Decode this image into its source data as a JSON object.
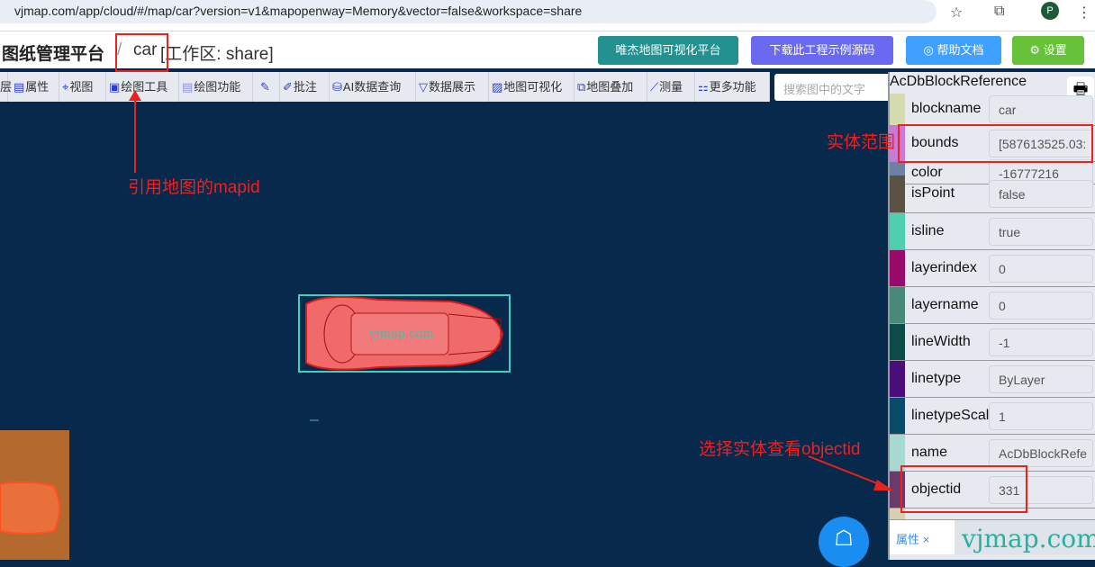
{
  "browser": {
    "url": "vjmap.com/app/cloud/#/map/car?version=v1&mapopenway=Memory&vector=false&workspace=share",
    "avatar": "P"
  },
  "header": {
    "title": "图纸管理平台",
    "separator": "/",
    "map_name": "car",
    "workspace": "[工作区: share]",
    "buttons": [
      {
        "label": "唯杰地图可视化平台",
        "color": "#22918f"
      },
      {
        "label": "下载此工程示例源码",
        "color": "#6a6af0"
      },
      {
        "label": "◎ 帮助文档",
        "color": "#40a0ff"
      },
      {
        "label": "⚙ 设置",
        "color": "#67c23a"
      }
    ]
  },
  "toolbar": {
    "items": [
      "层",
      "属性",
      "视图",
      "绘图工具",
      "绘图功能",
      "",
      "批注",
      "AI数据查询",
      "数据展示",
      "地图可视化",
      "地图叠加",
      "测量",
      "更多功能"
    ],
    "search_placeholder": "搜索图中的文字"
  },
  "panel": {
    "title": "AcDbBlockReference",
    "rows": [
      {
        "label": "blockname",
        "value": "car",
        "color": "#d6dab0"
      },
      {
        "label": "bounds",
        "value": "[587613525.03:",
        "color": "#c97ad8"
      },
      {
        "label": "color",
        "value": "-16777216",
        "color": "#6d82a3"
      },
      {
        "label": "isPoint",
        "value": "false",
        "color": "#5a5244"
      },
      {
        "label": "isline",
        "value": "true",
        "color": "#4fcfb0"
      },
      {
        "label": "layerindex",
        "value": "0",
        "color": "#9a0a6a"
      },
      {
        "label": "layername",
        "value": "0",
        "color": "#4a8878"
      },
      {
        "label": "lineWidth",
        "value": "-1",
        "color": "#0e4a48"
      },
      {
        "label": "linetype",
        "value": "ByLayer",
        "color": "#4a0e7a"
      },
      {
        "label": "linetypeScale",
        "value": "1",
        "color": "#0a4a6a"
      },
      {
        "label": "name",
        "value": "AcDbBlockRefe",
        "color": "#a8d8d0"
      },
      {
        "label": "objectid",
        "value": "331",
        "color": "#6a3a6a"
      }
    ],
    "tab": "属性 ×",
    "watermark": "vjmap.com"
  },
  "map": {
    "car_watermark": "vjmap.com"
  },
  "annotations": {
    "mapid": "引用地图的mapid",
    "bounds": "实体范围",
    "objectid": "选择实体查看objectid"
  }
}
